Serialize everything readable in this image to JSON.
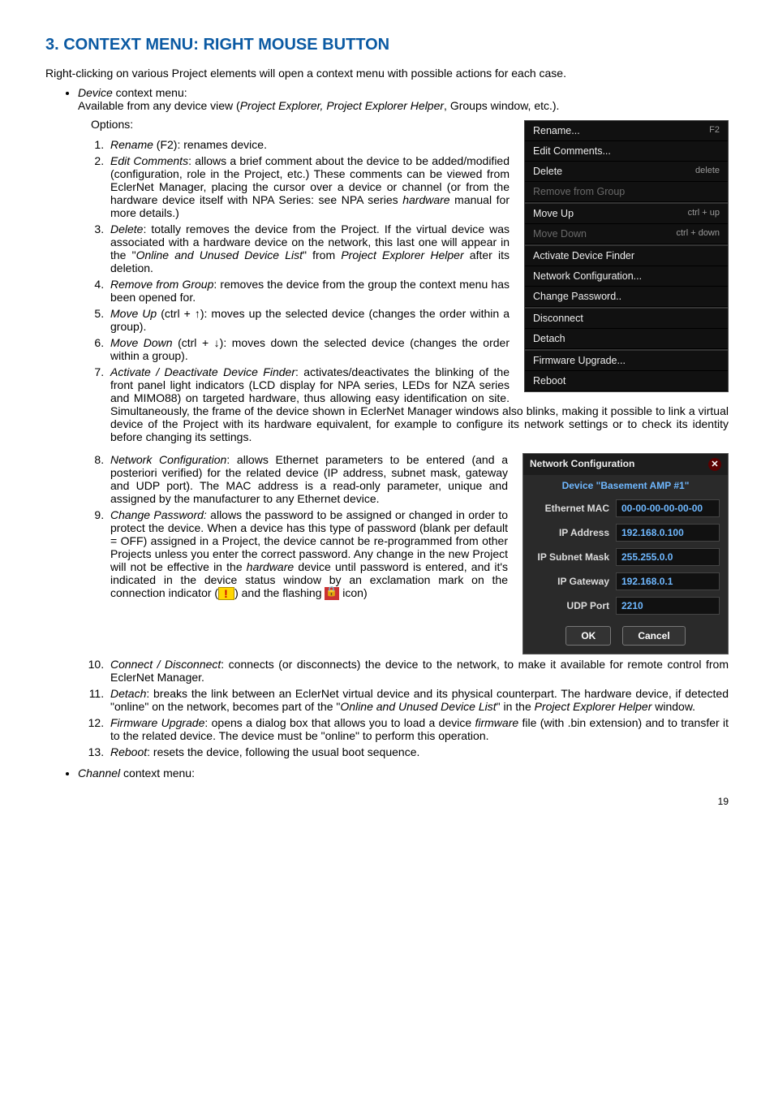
{
  "heading": "3. CONTEXT MENU: RIGHT MOUSE BUTTON",
  "intro": "Right-clicking on various Project elements will open a context menu with possible actions for each case.",
  "bullet_device": "Device",
  "bullet_device_rest": " context menu:",
  "bullet_device_line2_a": "Available from any device view (",
  "bullet_device_line2_i": "Project Explorer, Project Explorer Helper",
  "bullet_device_line2_b": ", Groups window, etc.).",
  "options_label": "Options:",
  "context_menu": {
    "rename": {
      "l": "Rename...",
      "sc": "F2"
    },
    "edit_comments": {
      "l": "Edit Comments..."
    },
    "delete": {
      "l": "Delete",
      "sc": "delete"
    },
    "remove_group": {
      "l": "Remove from Group"
    },
    "move_up": {
      "l": "Move Up",
      "sc": "ctrl + up"
    },
    "move_down": {
      "l": "Move Down",
      "sc": "ctrl + down"
    },
    "activate_finder": {
      "l": "Activate Device Finder"
    },
    "net_cfg": {
      "l": "Network Configuration..."
    },
    "change_pw": {
      "l": "Change Password.."
    },
    "disconnect": {
      "l": "Disconnect"
    },
    "detach": {
      "l": "Detach"
    },
    "firmware": {
      "l": "Firmware Upgrade..."
    },
    "reboot": {
      "l": "Reboot"
    }
  },
  "items": {
    "i1_a": "Rename",
    "i1_b": " (F2): renames device.",
    "i2_a": "Edit Comments",
    "i2_b": ": allows a brief comment about the device to be added/modified (configuration, role in the Project, etc.) These comments can be viewed from EclerNet Manager, placing the cursor over a device or channel (or from the hardware device itself with NPA Series: see NPA series ",
    "i2_c": "hardware",
    "i2_d": " manual for more details.)",
    "i3_a": "Delete",
    "i3_b": ": totally removes the device from the Project. If the virtual device was associated with a hardware device on the network, this last one will appear in the \"",
    "i3_c": "Online and Unused Device List",
    "i3_d": "\" from ",
    "i3_e": "Project Explorer Helper",
    "i3_f": " after its deletion.",
    "i4_a": "Remove from Group",
    "i4_b": ": removes the device from the group the context menu has been opened for.",
    "i5_a": "Move Up",
    "i5_b": " (ctrl + ↑): moves up the selected device (changes the order within a group).",
    "i6_a": "Move Down",
    "i6_b": " (ctrl + ↓): moves down the selected device (changes the order within a group).",
    "i7_a": "Activate / Deactivate Device Finder",
    "i7_b": ": activates/deactivates the blinking of the front panel light indicators (LCD display for NPA series, LEDs for NZA series and MIMO88) on targeted hardware, thus allowing easy identification on site. Simultaneously, the frame of the device shown in EclerNet Manager windows also blinks, making it possible to link a virtual device of the Project with its hardware equivalent, for example to configure its network settings or to check its identity before changing its settings.",
    "i8_a": "Network Configuration",
    "i8_b": ": allows Ethernet parameters to be entered (and a posteriori verified) for the related device (IP address, subnet mask, gateway and UDP port). The MAC address is a read-only parameter, unique and assigned by the manufacturer to any Ethernet device.",
    "i9_a": "Change Password:",
    "i9_b": " allows the password to be assigned or changed in order to protect the device. When a device has this type of password (blank per default = OFF) assigned in a Project, the device cannot be re-programmed from other Projects unless you enter the correct password. Any change in the new Project will not be effective in the ",
    "i9_c": "hardware",
    "i9_d": " device until password is entered, and it's indicated in the device status window by an exclamation mark on the connection indicator (",
    "i9_e": ") and the flashing ",
    "i9_f": " icon)",
    "i10_a": "Connect / Disconnect",
    "i10_b": ": connects (or disconnects) the device to the network, to make it available for remote control from EclerNet Manager.",
    "i11_a": "Detach",
    "i11_b": ": breaks the link between an EclerNet virtual device and its physical counterpart. The hardware device, if detected \"online\" on the network, becomes part of the \"",
    "i11_c": "Online and Unused Device List",
    "i11_d": "\" in the ",
    "i11_e": "Project Explorer Helper",
    "i11_f": " window.",
    "i12_a": "Firmware Upgrade",
    "i12_b": ": opens a dialog box that allows you to load a device ",
    "i12_c": "firmware",
    "i12_d": " file (with .bin extension) and to transfer it to the related device. The device must be \"online\" to perform this operation.",
    "i13_a": "Reboot",
    "i13_b": ": resets the device, following the usual boot sequence."
  },
  "netcfg": {
    "title": "Network Configuration",
    "device": "Device \"Basement AMP #1\"",
    "mac_l": "Ethernet MAC",
    "mac_v": "00-00-00-00-00-00",
    "ip_l": "IP Address",
    "ip_v": "192.168.0.100",
    "mask_l": "IP Subnet Mask",
    "mask_v": "255.255.0.0",
    "gw_l": "IP Gateway",
    "gw_v": "192.168.0.1",
    "port_l": "UDP Port",
    "port_v": "2210",
    "ok": "OK",
    "cancel": "Cancel"
  },
  "bullet_channel": "Channel",
  "bullet_channel_rest": " context menu:",
  "page": "19"
}
